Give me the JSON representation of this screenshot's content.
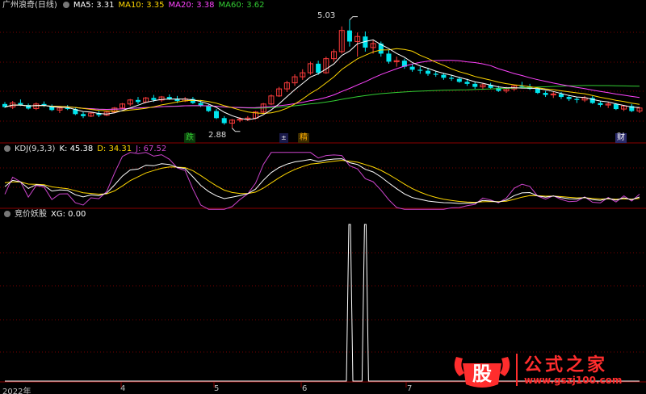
{
  "colors": {
    "up": "#ff3c3c",
    "down": "#00e5ee",
    "ma5": "#ffffff",
    "ma10": "#ffd700",
    "ma20": "#ff44ff",
    "ma60": "#33cc33",
    "kdj_k": "#ffffff",
    "kdj_d": "#ffd700",
    "kdj_j": "#cc44cc",
    "grid": "#7a0000",
    "xg_line": "#ffffff"
  },
  "header": {
    "title": "广州浪奇(日线)",
    "ma5": "MA5: 3.31",
    "ma10": "MA10: 3.35",
    "ma20": "MA20: 3.38",
    "ma60": "MA60: 3.62"
  },
  "kdj_header": {
    "name": "KDJ(9,3,3)",
    "k": "K: 45.38",
    "d": "D: 34.31",
    "j": "J: 67.52"
  },
  "xg_header": {
    "name": "竞价妖股",
    "xg": "XG: 0.00"
  },
  "annotations": {
    "high": "5.03",
    "low": "2.88"
  },
  "event_tags": [
    {
      "text": "跌",
      "color": "#33cc33",
      "bg": "#0b3a0b"
    },
    {
      "text": "±",
      "color": "#ffffff",
      "bg": "#1a1a4a"
    },
    {
      "text": "精",
      "color": "#ffae00",
      "bg": "#3a2a00"
    },
    {
      "text": "财",
      "color": "#ffffff",
      "bg": "#2a2a6a"
    }
  ],
  "x_labels": [
    "2022年",
    "4",
    "5",
    "6",
    "7"
  ],
  "watermark": {
    "icon_text": "股",
    "brand": "公式之家",
    "url": "www.gszj100.com"
  },
  "chart_data": [
    {
      "type": "candlestick",
      "title": "广州浪奇(日线)",
      "series": [
        {
          "name": "MA5",
          "value": 3.31
        },
        {
          "name": "MA10",
          "value": 3.35
        },
        {
          "name": "MA20",
          "value": 3.38
        },
        {
          "name": "MA60",
          "value": 3.62
        }
      ],
      "marked_high": 5.03,
      "marked_low": 2.88,
      "ylim": [
        2.7,
        5.2
      ],
      "ohlc": [
        [
          3.36,
          3.4,
          3.28,
          3.3
        ],
        [
          3.3,
          3.42,
          3.26,
          3.38
        ],
        [
          3.38,
          3.45,
          3.32,
          3.34
        ],
        [
          3.34,
          3.37,
          3.25,
          3.27
        ],
        [
          3.27,
          3.39,
          3.24,
          3.36
        ],
        [
          3.36,
          3.41,
          3.3,
          3.32
        ],
        [
          3.32,
          3.35,
          3.22,
          3.24
        ],
        [
          3.24,
          3.3,
          3.18,
          3.28
        ],
        [
          3.28,
          3.34,
          3.24,
          3.26
        ],
        [
          3.26,
          3.29,
          3.14,
          3.16
        ],
        [
          3.16,
          3.2,
          3.08,
          3.12
        ],
        [
          3.12,
          3.2,
          3.1,
          3.18
        ],
        [
          3.18,
          3.22,
          3.1,
          3.14
        ],
        [
          3.14,
          3.22,
          3.12,
          3.2
        ],
        [
          3.2,
          3.3,
          3.18,
          3.28
        ],
        [
          3.28,
          3.38,
          3.26,
          3.36
        ],
        [
          3.36,
          3.46,
          3.32,
          3.44
        ],
        [
          3.44,
          3.5,
          3.36,
          3.4
        ],
        [
          3.4,
          3.5,
          3.38,
          3.48
        ],
        [
          3.48,
          3.54,
          3.4,
          3.44
        ],
        [
          3.44,
          3.52,
          3.4,
          3.5
        ],
        [
          3.5,
          3.55,
          3.44,
          3.46
        ],
        [
          3.46,
          3.52,
          3.38,
          3.42
        ],
        [
          3.42,
          3.5,
          3.4,
          3.46
        ],
        [
          3.46,
          3.5,
          3.36,
          3.38
        ],
        [
          3.38,
          3.44,
          3.3,
          3.32
        ],
        [
          3.32,
          3.36,
          3.2,
          3.22
        ],
        [
          3.22,
          3.26,
          3.06,
          3.08
        ],
        [
          3.08,
          3.12,
          2.95,
          2.98
        ],
        [
          2.98,
          3.06,
          2.88,
          3.04
        ],
        [
          3.04,
          3.1,
          3.0,
          3.06
        ],
        [
          3.06,
          3.12,
          3.02,
          3.08
        ],
        [
          3.08,
          3.22,
          3.06,
          3.2
        ],
        [
          3.2,
          3.38,
          3.18,
          3.36
        ],
        [
          3.36,
          3.55,
          3.34,
          3.52
        ],
        [
          3.52,
          3.7,
          3.5,
          3.66
        ],
        [
          3.66,
          3.82,
          3.6,
          3.78
        ],
        [
          3.78,
          3.95,
          3.72,
          3.9
        ],
        [
          3.9,
          4.05,
          3.84,
          3.98
        ],
        [
          3.98,
          4.2,
          3.94,
          4.16
        ],
        [
          4.16,
          4.22,
          3.94,
          3.98
        ],
        [
          3.98,
          4.3,
          3.96,
          4.26
        ],
        [
          4.26,
          4.45,
          4.2,
          4.4
        ],
        [
          4.4,
          4.9,
          4.36,
          4.82
        ],
        [
          4.82,
          5.03,
          4.5,
          4.6
        ],
        [
          4.6,
          4.78,
          4.3,
          4.7
        ],
        [
          4.7,
          4.8,
          4.4,
          4.48
        ],
        [
          4.48,
          4.62,
          4.36,
          4.56
        ],
        [
          4.56,
          4.6,
          4.3,
          4.36
        ],
        [
          4.36,
          4.44,
          4.16,
          4.2
        ],
        [
          4.2,
          4.3,
          4.1,
          4.22
        ],
        [
          4.22,
          4.26,
          4.06,
          4.1
        ],
        [
          4.1,
          4.16,
          4.0,
          4.04
        ],
        [
          4.04,
          4.1,
          3.96,
          4.02
        ],
        [
          4.02,
          4.08,
          3.92,
          3.96
        ],
        [
          3.96,
          4.02,
          3.9,
          3.94
        ],
        [
          3.94,
          3.98,
          3.84,
          3.88
        ],
        [
          3.88,
          3.94,
          3.82,
          3.86
        ],
        [
          3.86,
          3.9,
          3.78,
          3.8
        ],
        [
          3.8,
          3.86,
          3.72,
          3.76
        ],
        [
          3.76,
          3.8,
          3.66,
          3.7
        ],
        [
          3.7,
          3.78,
          3.64,
          3.74
        ],
        [
          3.74,
          3.78,
          3.66,
          3.68
        ],
        [
          3.68,
          3.72,
          3.6,
          3.62
        ],
        [
          3.62,
          3.7,
          3.58,
          3.66
        ],
        [
          3.66,
          3.74,
          3.62,
          3.72
        ],
        [
          3.72,
          3.8,
          3.68,
          3.7
        ],
        [
          3.7,
          3.76,
          3.64,
          3.66
        ],
        [
          3.66,
          3.7,
          3.56,
          3.58
        ],
        [
          3.58,
          3.62,
          3.5,
          3.54
        ],
        [
          3.54,
          3.6,
          3.48,
          3.56
        ],
        [
          3.56,
          3.6,
          3.46,
          3.5
        ],
        [
          3.5,
          3.54,
          3.42,
          3.46
        ],
        [
          3.46,
          3.5,
          3.38,
          3.44
        ],
        [
          3.44,
          3.52,
          3.4,
          3.48
        ],
        [
          3.48,
          3.52,
          3.36,
          3.38
        ],
        [
          3.38,
          3.42,
          3.3,
          3.34
        ],
        [
          3.34,
          3.4,
          3.28,
          3.36
        ],
        [
          3.36,
          3.38,
          3.24,
          3.26
        ],
        [
          3.26,
          3.34,
          3.22,
          3.32
        ],
        [
          3.32,
          3.36,
          3.2,
          3.22
        ],
        [
          3.22,
          3.3,
          3.18,
          3.28
        ]
      ]
    },
    {
      "type": "line",
      "title": "KDJ(9,3,3)",
      "series": [
        {
          "name": "K",
          "last": 45.38
        },
        {
          "name": "D",
          "last": 34.31
        },
        {
          "name": "J",
          "last": 67.52
        }
      ],
      "ylim": [
        0,
        100
      ]
    },
    {
      "type": "line",
      "title": "竞价妖股",
      "series": [
        {
          "name": "XG",
          "last": 0.0
        }
      ],
      "ylim": [
        0,
        1
      ],
      "signal_days": [
        44,
        46
      ]
    }
  ]
}
